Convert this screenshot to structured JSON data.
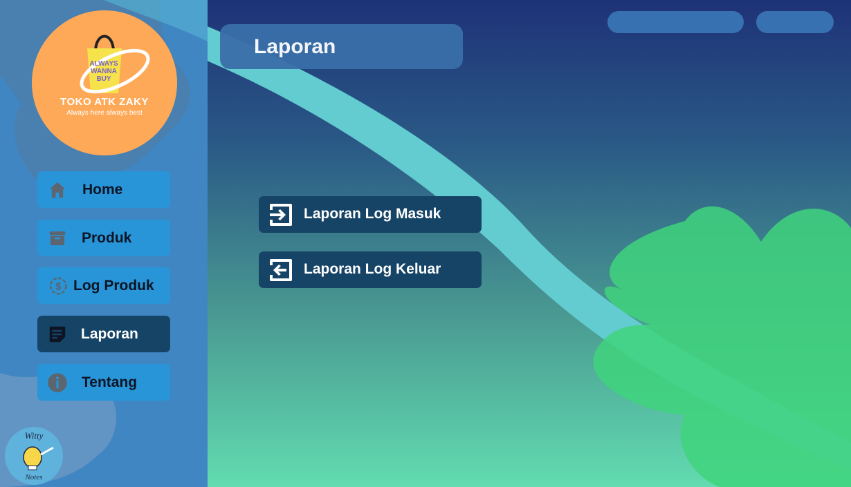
{
  "brand": {
    "logo_badge": "ALWAYS WANNA BUY",
    "name": "TOKO ATK ZAKY",
    "tagline": "Always here always best"
  },
  "sidebar": {
    "items": [
      {
        "label": "Home",
        "icon": "home-icon"
      },
      {
        "label": "Produk",
        "icon": "archive-box-icon"
      },
      {
        "label": "Log Produk",
        "icon": "dollar-history-icon"
      },
      {
        "label": "Laporan",
        "icon": "note-icon",
        "active": true
      },
      {
        "label": "Tentang",
        "icon": "info-icon"
      }
    ]
  },
  "footer_logo": {
    "line1": "Witty",
    "line2": "Notes"
  },
  "header": {
    "title": "Laporan"
  },
  "reports": [
    {
      "label": "Laporan Log Masuk",
      "icon": "login-icon"
    },
    {
      "label": "Laporan Log Keluar",
      "icon": "logout-icon"
    }
  ],
  "colors": {
    "nav": "#2895d8",
    "nav_active": "#164466",
    "logo_bg": "#fea957",
    "title_box": "#3a6faa"
  }
}
